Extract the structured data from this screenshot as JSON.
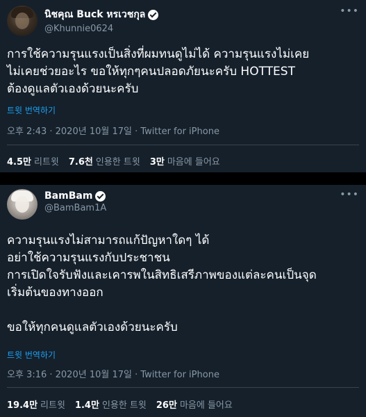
{
  "tweets": [
    {
      "display_name": "นิชคุณ Buck หรเวชกุล",
      "handle": "@Khunnie0624",
      "text": "การใช้ความรุนแรงเป็นสิ่งที่ผมทนดูไม่ได้ ความรุนแรงไม่เคย\nไม่เคยช่วยอะไร ขอให้ทุกๆคนปลอดภัยนะครับ HOTTEST\nต้องดูแลตัวเองด้วยนะครับ",
      "translate": "트윗 번역하기",
      "meta": "오후 2:43 · 2020년 10월 17일 · Twitter for iPhone",
      "retweets_count": "4.5만",
      "retweets_label": "리트윗",
      "quotes_count": "7.6천",
      "quotes_label": "인용한 트윗",
      "likes_count": "3만",
      "likes_label": "마음에 들어요"
    },
    {
      "display_name": "BamBam",
      "handle": "@BamBam1A",
      "text": "ความรุนแรงไม่สามารถแก้ปัญหาใดๆ ได้\nอย่าใช้ความรุนแรงกับประชาชน\nการเปิดใจรับฟังและเคารพในสิทธิเสรีภาพของแต่ละคนเป็นจุด\nเริ่มต้นของทางออก\n\nขอให้ทุกคนดูแลตัวเองด้วยนะครับ",
      "translate": "트윗 번역하기",
      "meta": "오후 3:16 · 2020년 10월 17일 · Twitter for iPhone",
      "retweets_count": "19.4만",
      "retweets_label": "리트윗",
      "quotes_count": "1.4만",
      "quotes_label": "인용한 트윗",
      "likes_count": "26만",
      "likes_label": "마음에 들어요"
    }
  ],
  "icons": {
    "more": "more-horizontal-icon",
    "verified": "verified-badge-icon"
  },
  "colors": {
    "background": "#15202b",
    "accent": "#1da1f2",
    "muted": "#8899a6",
    "divider": "#38444d"
  }
}
